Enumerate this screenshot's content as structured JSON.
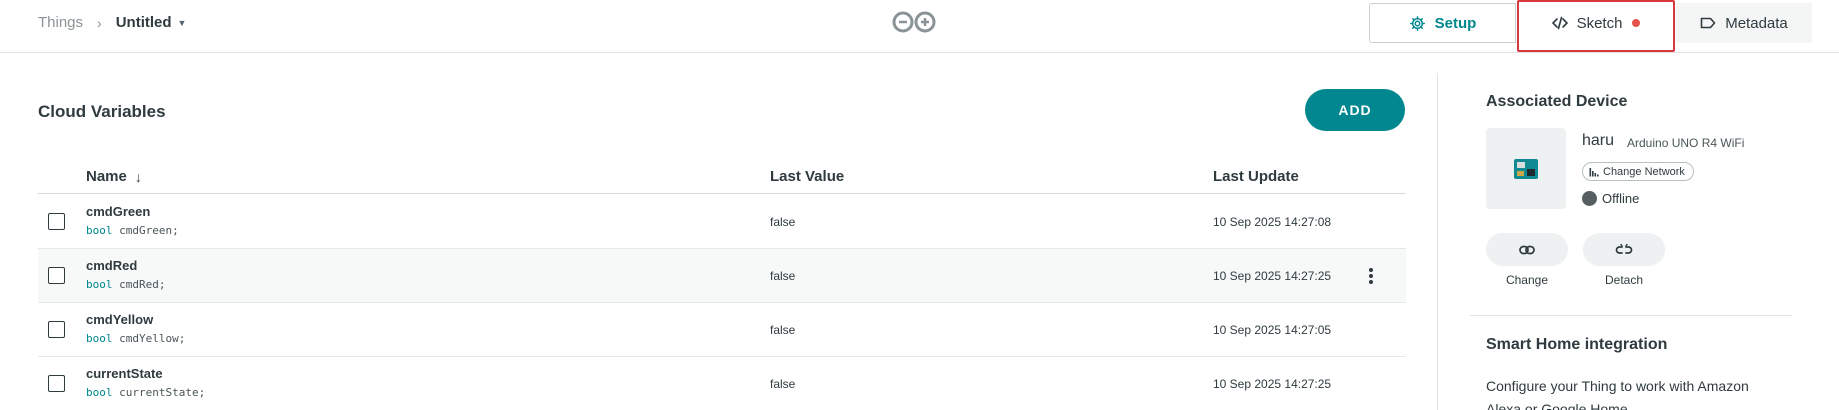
{
  "breadcrumb": {
    "root": "Things",
    "current": "Untitled"
  },
  "tabs": {
    "setup": "Setup",
    "sketch": "Sketch",
    "metadata": "Metadata"
  },
  "colors": {
    "accent": "#00878f",
    "highlight": "#d9383f",
    "sketch_dot": "#e5534b",
    "offline": "#555f62"
  },
  "main": {
    "title": "Cloud Variables",
    "add_label": "ADD",
    "columns": {
      "name": "Name",
      "last_value": "Last Value",
      "last_update": "Last Update"
    },
    "rows": [
      {
        "name": "cmdGreen",
        "type": "bool",
        "decl": "cmdGreen;",
        "value": "false",
        "updated": "10 Sep 2025 14:27:08"
      },
      {
        "name": "cmdRed",
        "type": "bool",
        "decl": "cmdRed;",
        "value": "false",
        "updated": "10 Sep 2025 14:27:25"
      },
      {
        "name": "cmdYellow",
        "type": "bool",
        "decl": "cmdYellow;",
        "value": "false",
        "updated": "10 Sep 2025 14:27:05"
      },
      {
        "name": "currentState",
        "type": "bool",
        "decl": "currentState;",
        "value": "false",
        "updated": "10 Sep 2025 14:27:25"
      }
    ]
  },
  "device": {
    "section_title": "Associated Device",
    "name": "haru",
    "model": "Arduino UNO R4 WiFi",
    "network_label": "Change Network",
    "status": "Offline",
    "change_label": "Change",
    "detach_label": "Detach"
  },
  "smart_home": {
    "title": "Smart Home integration",
    "text": "Configure your Thing to work with Amazon Alexa or Google Home"
  }
}
